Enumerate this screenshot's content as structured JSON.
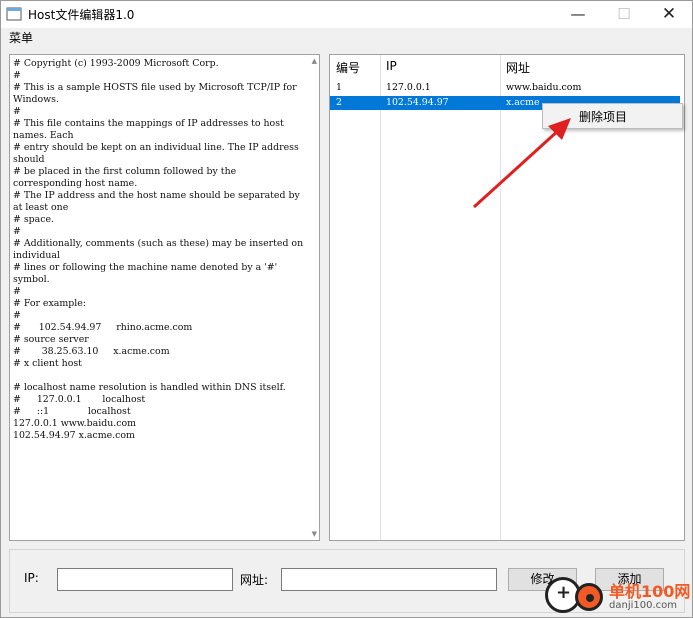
{
  "window": {
    "title": "Host文件编辑器1.0",
    "min_glyph": "—",
    "max_glyph": "☐",
    "close_glyph": "✕"
  },
  "menu": {
    "item": "菜单"
  },
  "hosts_text": "# Copyright (c) 1993-2009 Microsoft Corp.\n#\n# This is a sample HOSTS file used by Microsoft TCP/IP for Windows.\n#\n# This file contains the mappings of IP addresses to host names. Each\n# entry should be kept on an individual line. The IP address should\n# be placed in the first column followed by the corresponding host name.\n# The IP address and the host name should be separated by at least one\n# space.\n#\n# Additionally, comments (such as these) may be inserted on individual\n# lines or following the machine name denoted by a '#' symbol.\n#\n# For example:\n#\n#      102.54.94.97     rhino.acme.com\n# source server\n#       38.25.63.10     x.acme.com\n# x client host\n\n# localhost name resolution is handled within DNS itself.\n#\t127.0.0.1       localhost\n#\t::1             localhost\n127.0.0.1 www.baidu.com\n102.54.94.97 x.acme.com",
  "table": {
    "headers": {
      "num": "编号",
      "ip": "IP",
      "url": "网址"
    },
    "rows": [
      {
        "num": "1",
        "ip": "127.0.0.1",
        "url": "www.baidu.com"
      },
      {
        "num": "2",
        "ip": "102.54.94.97",
        "url": "x.acme"
      }
    ],
    "selected_row": 2
  },
  "context_menu": {
    "item": "删除项目"
  },
  "form": {
    "ip_label": "IP:",
    "ip_value": "",
    "url_label": "网址:",
    "url_value": "",
    "edit_button": "修改",
    "add_button": "添加"
  },
  "watermark": {
    "line1": "单机100网",
    "line2": "danji100.com"
  },
  "colors": {
    "selection": "#0078d7",
    "arrow": "#e02020",
    "watermark": "#f15a24"
  },
  "icons": {
    "app": "app-window-icon",
    "arrow": "red-pointer-arrow"
  }
}
